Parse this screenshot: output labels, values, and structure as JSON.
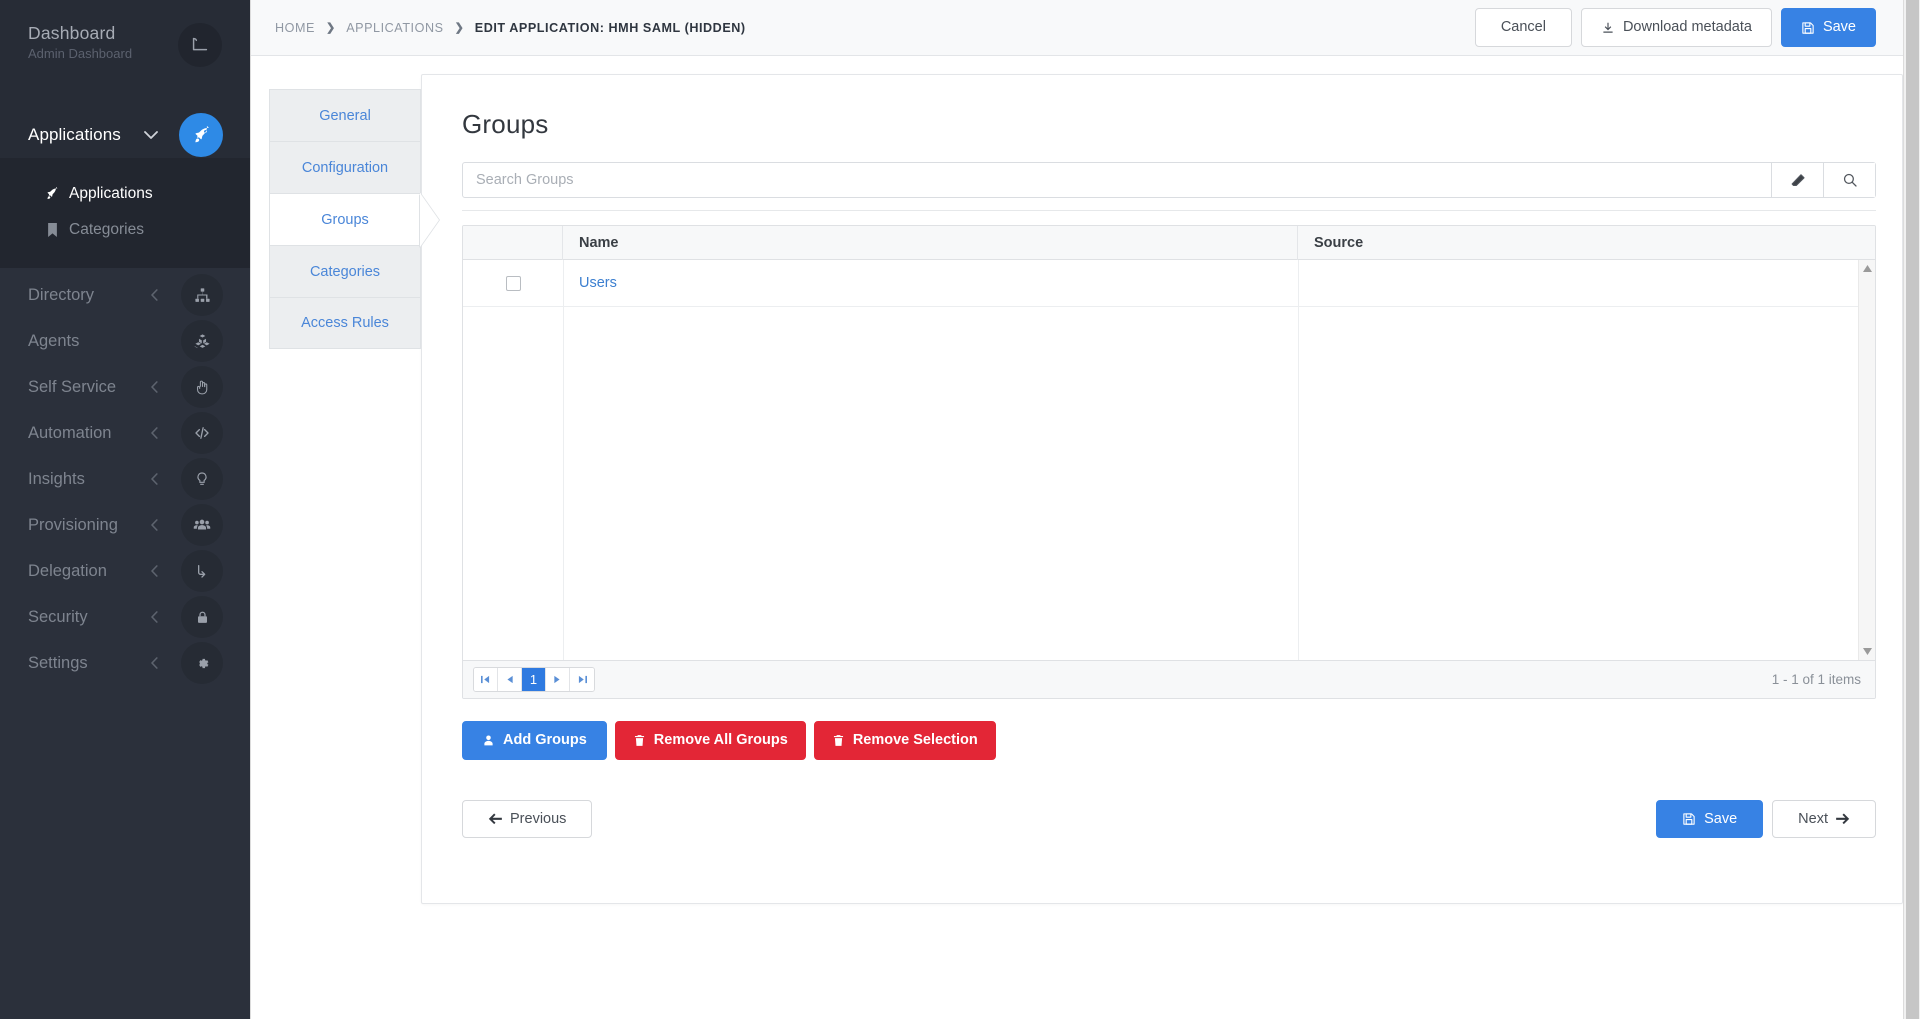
{
  "sidebar": {
    "brand": {
      "title": "Dashboard",
      "subtitle": "Admin Dashboard",
      "badge_icon": "ruler-icon"
    },
    "section": {
      "label": "Applications",
      "caret_icon": "chevron-down-icon",
      "circle_icon": "rocket-icon"
    },
    "sub_items": [
      {
        "label": "Applications",
        "icon": "rocket-icon",
        "active": true
      },
      {
        "label": "Categories",
        "icon": "bookmark-icon",
        "active": false
      }
    ],
    "nav_items": [
      {
        "label": "Directory",
        "icon": "sitemap-icon",
        "caret": true
      },
      {
        "label": "Agents",
        "icon": "cubes-icon",
        "caret": false
      },
      {
        "label": "Self Service",
        "icon": "hand-pointer-icon",
        "caret": true
      },
      {
        "label": "Automation",
        "icon": "code-icon",
        "caret": true
      },
      {
        "label": "Insights",
        "icon": "lightbulb-icon",
        "caret": true
      },
      {
        "label": "Provisioning",
        "icon": "users-icon",
        "caret": true
      },
      {
        "label": "Delegation",
        "icon": "arrow-turn-down-icon",
        "caret": true
      },
      {
        "label": "Security",
        "icon": "lock-icon",
        "caret": true
      },
      {
        "label": "Settings",
        "icon": "gear-icon",
        "caret": true
      }
    ],
    "caret_glyph": "‹"
  },
  "topbar": {
    "breadcrumb": [
      {
        "label": "HOME",
        "current": false
      },
      {
        "label": "APPLICATIONS",
        "current": false
      },
      {
        "label": "EDIT APPLICATION: HMH SAML (HIDDEN)",
        "current": true
      }
    ],
    "separator": "❯",
    "cancel_label": "Cancel",
    "download_label": "Download metadata",
    "save_label": "Save"
  },
  "tabs": [
    {
      "label": "General",
      "active": false
    },
    {
      "label": "Configuration",
      "active": false
    },
    {
      "label": "Groups",
      "active": true
    },
    {
      "label": "Categories",
      "active": false
    },
    {
      "label": "Access Rules",
      "active": false
    }
  ],
  "panel": {
    "title": "Groups",
    "search": {
      "placeholder": "Search Groups",
      "value": "",
      "clear_icon": "eraser-icon",
      "search_icon": "search-icon"
    },
    "grid": {
      "columns": [
        "",
        "Name",
        "Source"
      ],
      "rows": [
        {
          "checked": false,
          "name": "Users",
          "source": ""
        }
      ]
    },
    "pager": {
      "first": "⏮",
      "prev": "◀",
      "pages": [
        "1"
      ],
      "current_page": "1",
      "next": "▶",
      "last": "⏭",
      "info": "1 - 1 of 1 items"
    },
    "actions": [
      {
        "label": "Add Groups",
        "icon": "user-icon",
        "style": "primary"
      },
      {
        "label": "Remove All Groups",
        "icon": "trash-icon",
        "style": "danger"
      },
      {
        "label": "Remove Selection",
        "icon": "trash-icon",
        "style": "danger"
      }
    ],
    "footer": {
      "previous_label": "Previous",
      "save_label": "Save",
      "next_label": "Next"
    }
  },
  "colors": {
    "sidebar_bg": "#2b303b",
    "sidebar_dark": "#22262f",
    "accent_blue": "#3782e4",
    "danger_red": "#e32636",
    "link_blue": "#3c7fd0",
    "tab_blue": "#4a86d8"
  }
}
